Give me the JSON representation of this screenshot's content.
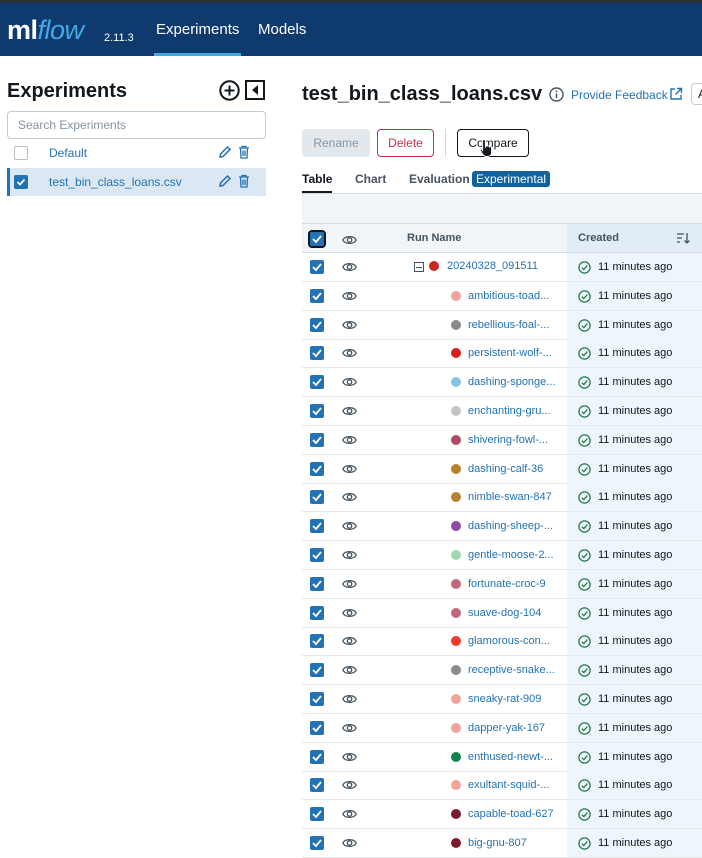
{
  "header": {
    "logo_ml": "ml",
    "logo_flow": "flow",
    "version": "2.11.3",
    "nav": [
      {
        "label": "Experiments"
      },
      {
        "label": "Models"
      }
    ],
    "bg_color": "#0e3a6e",
    "accent_color": "#42a8e8"
  },
  "sidebar": {
    "title": "Experiments",
    "search_placeholder": "Search Experiments",
    "items": [
      {
        "label": "Default",
        "selected": false
      },
      {
        "label": "test_bin_class_loans.csv",
        "selected": true
      }
    ]
  },
  "main": {
    "title": "test_bin_class_loans.csv",
    "feedback_label": "Provide Feedback",
    "cut_button_label": "A",
    "buttons": {
      "rename": "Rename",
      "delete": "Delete",
      "compare": "Compare"
    },
    "tabs": [
      {
        "label": "Table",
        "active": true
      },
      {
        "label": "Chart"
      },
      {
        "label": "Evaluation"
      }
    ],
    "experimental_badge": "Experimental"
  },
  "table": {
    "columns": {
      "run_name": "Run Name",
      "created": "Created"
    },
    "parent_run": {
      "name": "20240328_091511",
      "color": "#c9271f",
      "created": "11 minutes ago"
    },
    "rows": [
      {
        "name": "ambitious-toad...",
        "color": "#f2a49b",
        "created": "11 minutes ago"
      },
      {
        "name": "rebellious-foal-...",
        "color": "#8a8a8a",
        "created": "11 minutes ago"
      },
      {
        "name": "persistent-wolf-...",
        "color": "#d6201b",
        "created": "11 minutes ago"
      },
      {
        "name": "dashing-sponge...",
        "color": "#86c4e2",
        "created": "11 minutes ago"
      },
      {
        "name": "enchanting-gru...",
        "color": "#c4c4c4",
        "created": "11 minutes ago"
      },
      {
        "name": "shivering-fowl-...",
        "color": "#ad4a63",
        "created": "11 minutes ago"
      },
      {
        "name": "dashing-calf-36",
        "color": "#b7812e",
        "created": "11 minutes ago"
      },
      {
        "name": "nimble-swan-847",
        "color": "#b7812e",
        "created": "11 minutes ago"
      },
      {
        "name": "dashing-sheep-...",
        "color": "#8e4aa6",
        "created": "11 minutes ago"
      },
      {
        "name": "gentle-moose-2...",
        "color": "#9fdab0",
        "created": "11 minutes ago"
      },
      {
        "name": "fortunate-croc-9",
        "color": "#c0677a",
        "created": "11 minutes ago"
      },
      {
        "name": "suave-dog-104",
        "color": "#c0677a",
        "created": "11 minutes ago"
      },
      {
        "name": "glamorous-con...",
        "color": "#ee3b2a",
        "created": "11 minutes ago"
      },
      {
        "name": "receptive-snake...",
        "color": "#8a8a8a",
        "created": "11 minutes ago"
      },
      {
        "name": "sneaky-rat-909",
        "color": "#f2a49b",
        "created": "11 minutes ago"
      },
      {
        "name": "dapper-yak-167",
        "color": "#f2a49b",
        "created": "11 minutes ago"
      },
      {
        "name": "enthused-newt-...",
        "color": "#13824f",
        "created": "11 minutes ago"
      },
      {
        "name": "exultant-squid-...",
        "color": "#f2a49b",
        "created": "11 minutes ago"
      },
      {
        "name": "capable-toad-627",
        "color": "#7a1a2d",
        "created": "11 minutes ago"
      },
      {
        "name": "big-gnu-807",
        "color": "#7a1a2d",
        "created": "11 minutes ago"
      }
    ]
  }
}
